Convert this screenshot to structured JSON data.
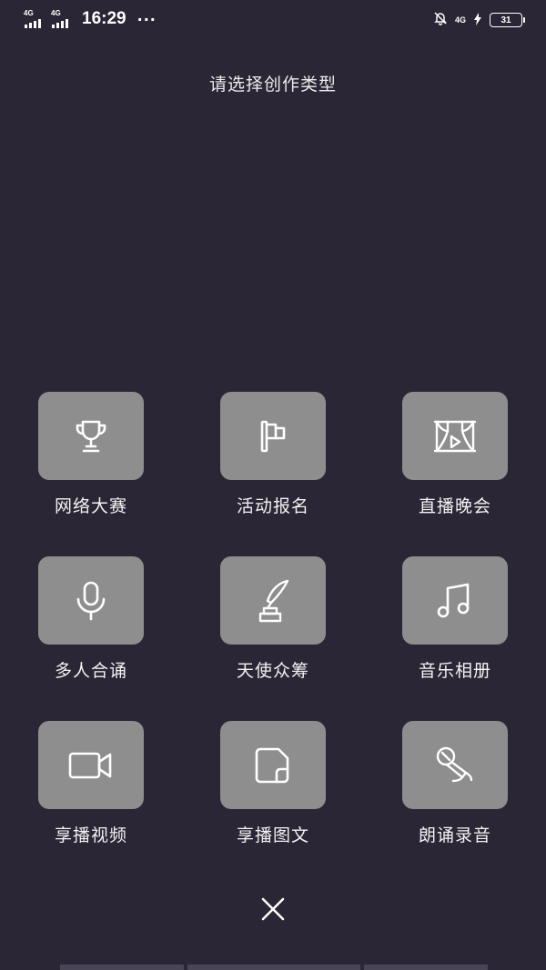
{
  "status_bar": {
    "network_1": "4G",
    "network_2": "4G",
    "time": "16:29",
    "more": "···",
    "net_right": "4G",
    "battery": "31"
  },
  "title": "请选择创作类型",
  "items": [
    {
      "label": "网络大赛",
      "icon": "trophy-icon"
    },
    {
      "label": "活动报名",
      "icon": "flag-icon"
    },
    {
      "label": "直播晚会",
      "icon": "stage-icon"
    },
    {
      "label": "多人合诵",
      "icon": "microphone-icon"
    },
    {
      "label": "天使众筹",
      "icon": "quill-ink-icon"
    },
    {
      "label": "音乐相册",
      "icon": "music-note-icon"
    },
    {
      "label": "享播视频",
      "icon": "video-camera-icon"
    },
    {
      "label": "享播图文",
      "icon": "document-icon"
    },
    {
      "label": "朗诵录音",
      "icon": "handheld-mic-icon"
    }
  ],
  "colors": {
    "background": "#2b2635",
    "tile": "#8e8e8e",
    "icon": "#ffffff"
  }
}
